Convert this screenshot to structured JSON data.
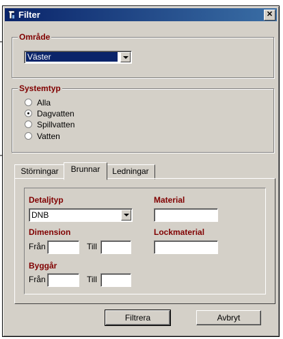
{
  "window": {
    "title": "Filter",
    "close_glyph": "✕",
    "icon": "filter-funnel-icon"
  },
  "area": {
    "legend": "Område",
    "selected": "Väster"
  },
  "system_type": {
    "legend": "Systemtyp",
    "options": [
      {
        "label": "Alla",
        "checked": false
      },
      {
        "label": "Dagvatten",
        "checked": true
      },
      {
        "label": "Spillvatten",
        "checked": false
      },
      {
        "label": "Vatten",
        "checked": false
      }
    ]
  },
  "tabs": [
    {
      "label": "Störningar",
      "active": false
    },
    {
      "label": "Brunnar",
      "active": true
    },
    {
      "label": "Ledningar",
      "active": false
    }
  ],
  "brunnar": {
    "detail_type_label": "Detaljtyp",
    "detail_type_value": "DNB",
    "material_label": "Material",
    "material_value": "",
    "dimension_label": "Dimension",
    "from_label": "Från",
    "to_label": "Till",
    "dimension_from": "",
    "dimension_to": "",
    "lock_material_label": "Lockmaterial",
    "lock_material_value": "",
    "build_year_label": "Byggår",
    "build_year_from": "",
    "build_year_to": ""
  },
  "buttons": {
    "filter": "Filtrera",
    "cancel": "Avbryt"
  },
  "colors": {
    "title_bar": "#0a246a",
    "label": "#800000",
    "face": "#d4d0c8"
  }
}
